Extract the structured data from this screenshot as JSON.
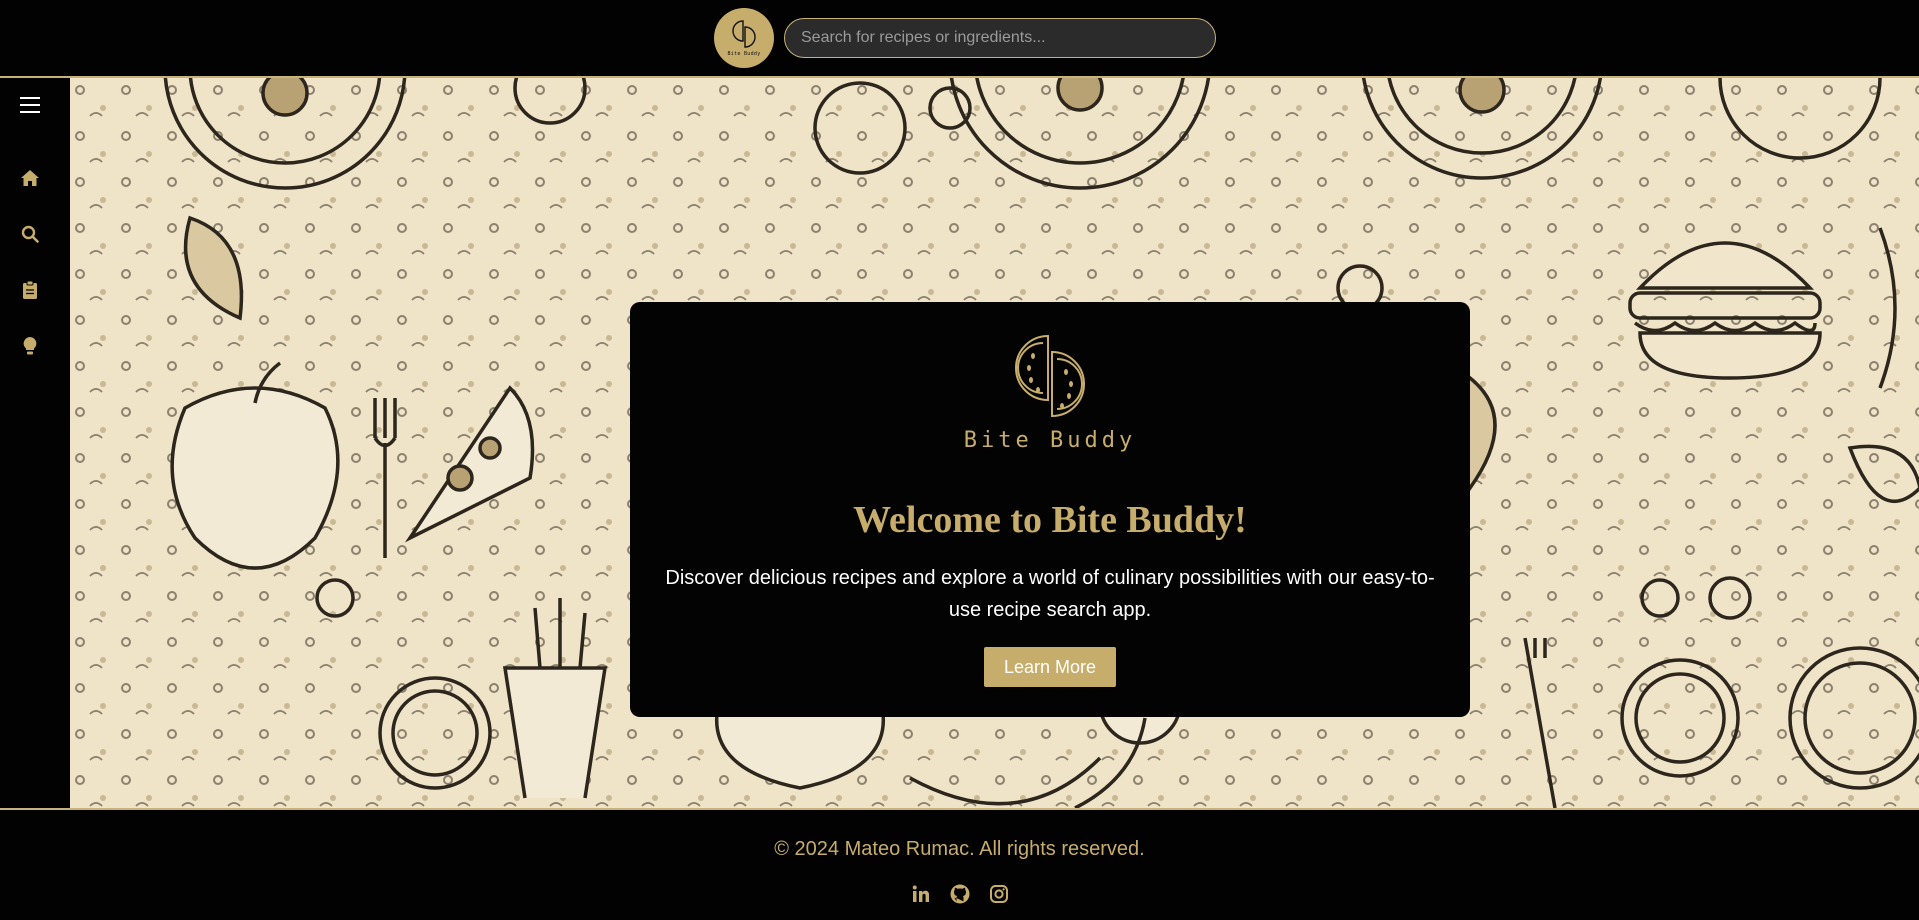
{
  "header": {
    "logo_text": "Bite Buddy",
    "search_placeholder": "Search for recipes or ingredients..."
  },
  "sidebar": {
    "items": [
      {
        "name": "menu",
        "icon": "hamburger-icon"
      },
      {
        "name": "home",
        "icon": "home-icon"
      },
      {
        "name": "search",
        "icon": "search-icon"
      },
      {
        "name": "recipes",
        "icon": "clipboard-icon"
      },
      {
        "name": "tips",
        "icon": "lightbulb-icon"
      }
    ]
  },
  "hero": {
    "brand_name": "Bite Buddy",
    "title": "Welcome to Bite Buddy!",
    "description": "Discover delicious recipes and explore a world of culinary possibilities with our easy-to-use recipe search app.",
    "button_label": "Learn More"
  },
  "footer": {
    "copyright": "© 2024 Mateo Rumac. All rights reserved.",
    "social": [
      {
        "name": "linkedin",
        "icon": "linkedin-icon"
      },
      {
        "name": "github",
        "icon": "github-icon"
      },
      {
        "name": "instagram",
        "icon": "instagram-icon"
      }
    ]
  },
  "colors": {
    "accent": "#c7ad6c",
    "background": "#000000",
    "hero_background": "#efe3c8",
    "search_background": "#2b2b2b"
  }
}
